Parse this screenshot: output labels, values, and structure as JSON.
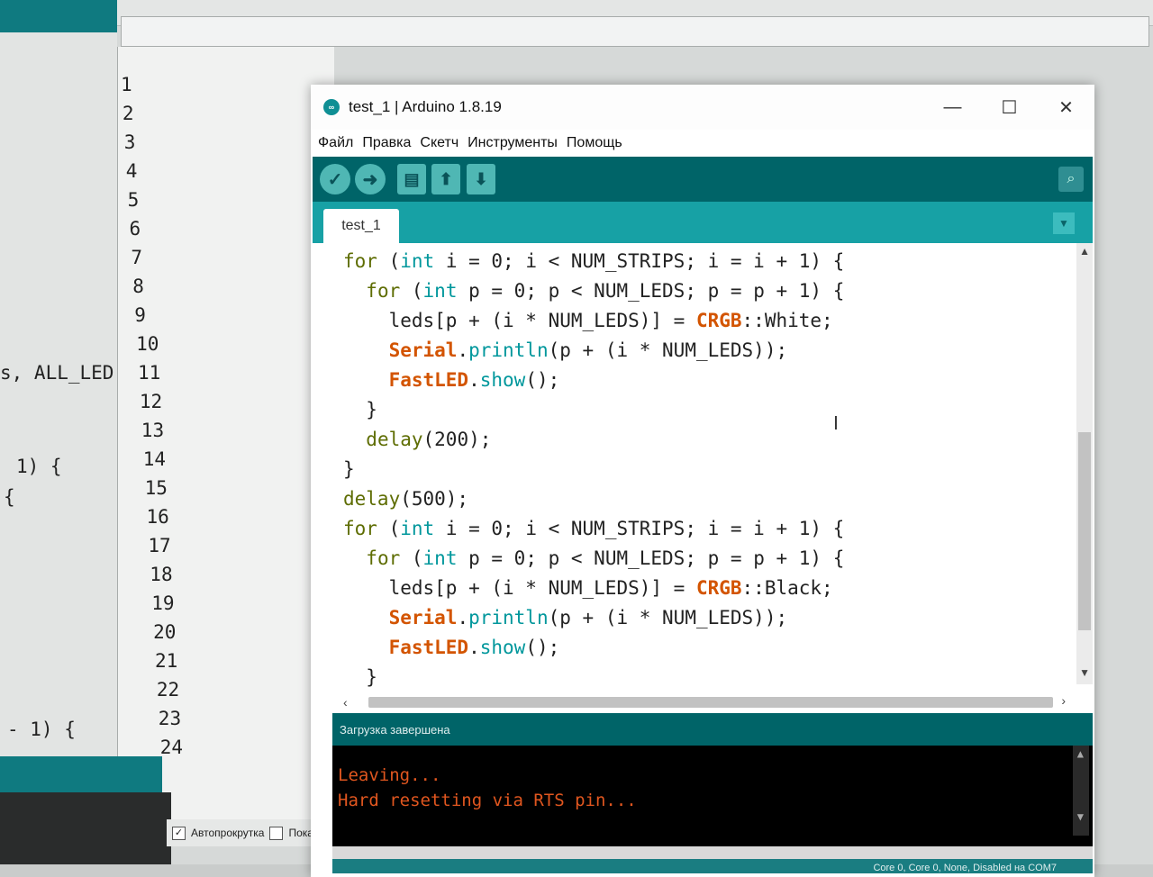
{
  "background": {
    "serial_numbers": [
      "1",
      "2",
      "3",
      "4",
      "5",
      "6",
      "7",
      "8",
      "9",
      "10",
      "11",
      "12",
      "13",
      "14",
      "15",
      "16",
      "17",
      "18",
      "19",
      "20",
      "21",
      "22",
      "23",
      "24"
    ],
    "left_code_fragments": [
      "s, ALL_LED",
      "1) {",
      "{",
      "- 1) {"
    ],
    "autoscroll_label": "Автопрокрутка",
    "show_label": "Показ"
  },
  "window": {
    "title": "test_1 | Arduino 1.8.19",
    "minimize": "—",
    "maximize": "☐",
    "close": "✕"
  },
  "menu": [
    "Файл",
    "Правка",
    "Скетч",
    "Инструменты",
    "Помощь"
  ],
  "toolbar": {
    "verify_icon": "✓",
    "upload_icon": "➜",
    "new_icon": "▤",
    "open_icon": "⬆",
    "save_icon": "⬇",
    "serial_icon": "⌕"
  },
  "tab": {
    "label": "test_1"
  },
  "code_lines": [
    {
      "indent": "",
      "parts": [
        [
          "kw",
          "for"
        ],
        [
          "",
          " ("
        ],
        [
          "tp",
          "int"
        ],
        [
          "",
          " i = 0; i < NUM_STRIPS; i = i + 1) {"
        ]
      ]
    },
    {
      "indent": "  ",
      "parts": [
        [
          "kw",
          "for"
        ],
        [
          "",
          " ("
        ],
        [
          "tp",
          "int"
        ],
        [
          "",
          " p = 0; p < NUM_LEDS; p = p + 1) {"
        ]
      ]
    },
    {
      "indent": "    ",
      "parts": [
        [
          "",
          "leds[p + (i * NUM_LEDS)] = "
        ],
        [
          "cls",
          "CRGB"
        ],
        [
          "",
          "::White;"
        ]
      ]
    },
    {
      "indent": "    ",
      "parts": [
        [
          "cls",
          "Serial"
        ],
        [
          "",
          "."
        ],
        [
          "fn",
          "println"
        ],
        [
          "",
          "(p + (i * NUM_LEDS));"
        ]
      ]
    },
    {
      "indent": "    ",
      "parts": [
        [
          "cls",
          "FastLED"
        ],
        [
          "",
          "."
        ],
        [
          "fn",
          "show"
        ],
        [
          "",
          "();"
        ]
      ]
    },
    {
      "indent": "  ",
      "parts": [
        [
          "",
          "}"
        ]
      ]
    },
    {
      "indent": "  ",
      "parts": [
        [
          "kw",
          "delay"
        ],
        [
          "",
          "(200);"
        ]
      ]
    },
    {
      "indent": "",
      "parts": [
        [
          "",
          "}"
        ]
      ]
    },
    {
      "indent": "",
      "parts": [
        [
          "kw",
          "delay"
        ],
        [
          "",
          "(500);"
        ]
      ]
    },
    {
      "indent": "",
      "parts": [
        [
          "kw",
          "for"
        ],
        [
          "",
          " ("
        ],
        [
          "tp",
          "int"
        ],
        [
          "",
          " i = 0; i < NUM_STRIPS; i = i + 1) {"
        ]
      ]
    },
    {
      "indent": "  ",
      "parts": [
        [
          "kw",
          "for"
        ],
        [
          "",
          " ("
        ],
        [
          "tp",
          "int"
        ],
        [
          "",
          " p = 0; p < NUM_LEDS; p = p + 1) {"
        ]
      ]
    },
    {
      "indent": "    ",
      "parts": [
        [
          "",
          "leds[p + (i * NUM_LEDS)] = "
        ],
        [
          "cls",
          "CRGB"
        ],
        [
          "",
          "::Black;"
        ]
      ]
    },
    {
      "indent": "    ",
      "parts": [
        [
          "cls",
          "Serial"
        ],
        [
          "",
          "."
        ],
        [
          "fn",
          "println"
        ],
        [
          "",
          "(p + (i * NUM_LEDS));"
        ]
      ]
    },
    {
      "indent": "    ",
      "parts": [
        [
          "cls",
          "FastLED"
        ],
        [
          "",
          "."
        ],
        [
          "fn",
          "show"
        ],
        [
          "",
          "();"
        ]
      ]
    },
    {
      "indent": "  ",
      "parts": [
        [
          "",
          "}"
        ]
      ]
    }
  ],
  "status": {
    "message": "Загрузка завершена"
  },
  "console_lines": [
    "Leaving...",
    "Hard resetting via RTS pin..."
  ],
  "footer": {
    "board_info": "Core 0, Core 0, None, Disabled на COM7"
  },
  "colors": {
    "teal_dark": "#006468",
    "teal": "#17a1a5",
    "keyword": "#5e6d03",
    "type": "#00979c",
    "class": "#d35400",
    "console_text": "#e0561f"
  }
}
